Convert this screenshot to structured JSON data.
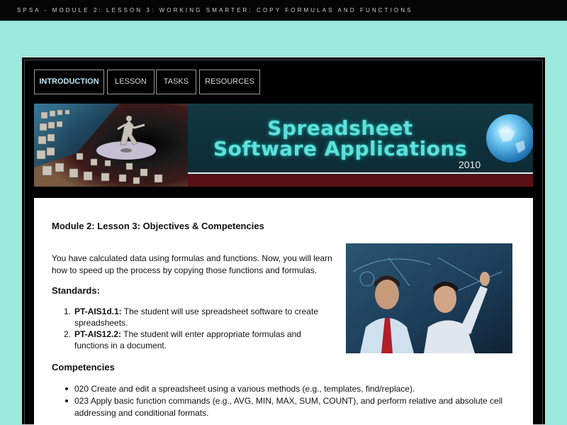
{
  "header": {
    "title": "SPSA - MODULE 2: LESSON 3: WORKING SMARTER: COPY FORMULAS AND FUNCTIONS"
  },
  "nav": {
    "tabs": [
      {
        "label": "INTRODUCTION",
        "active": true
      },
      {
        "label": "LESSON"
      },
      {
        "label": "TASKS"
      },
      {
        "label": "RESOURCES"
      }
    ]
  },
  "banner": {
    "title_line1": "Spreadsheet",
    "title_line2": "Software Applications",
    "year": "2010"
  },
  "content": {
    "title": "Module 2: Lesson 3: Objectives & Competencies",
    "intro": "You have calculated data using formulas and functions. Now, you will learn how to speed up the process by copying those functions and formulas.",
    "standards_heading": "Standards:",
    "standards": [
      {
        "code": "PT-AIS1d.1:",
        "text": " The student will use spreadsheet software to create spreadsheets."
      },
      {
        "code": "PT-AIS12.2:",
        "text": " The student will enter appropriate formulas and functions in a document."
      }
    ],
    "competencies_heading": "Competencies",
    "competencies": [
      "020 Create and edit a spreadsheet using a various methods (e.g., templates, find/replace).",
      "023 Apply basic function commands (e.g., AVG, MIN, MAX, SUM, COUNT), and perform relative and absolute cell addressing and conditional formats."
    ]
  }
}
